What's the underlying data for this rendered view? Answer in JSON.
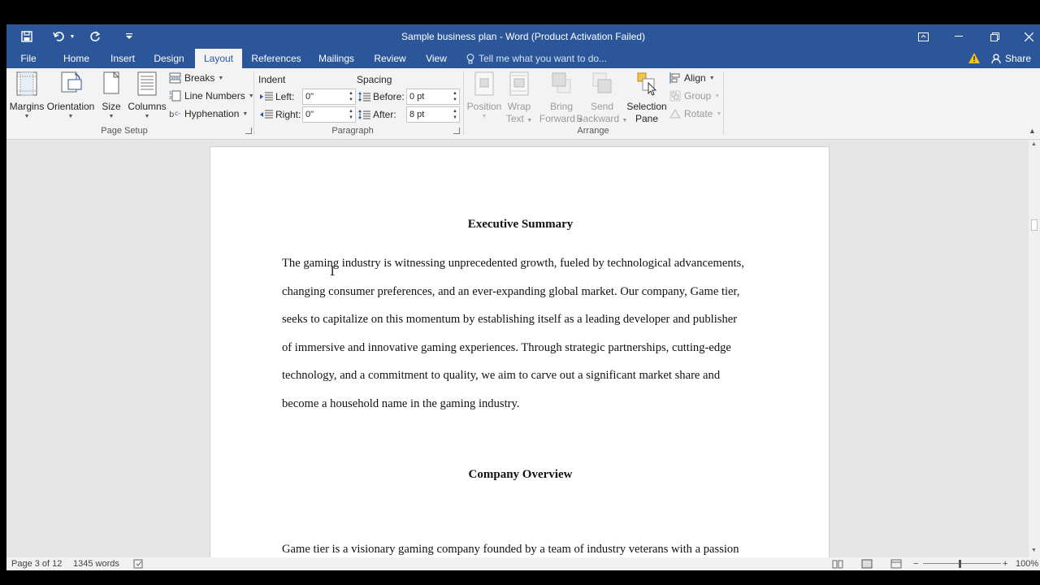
{
  "window": {
    "title": "Sample business plan - Word (Product Activation Failed)"
  },
  "quick_access": {
    "save_icon": "save-icon",
    "undo_icon": "undo-icon",
    "redo_icon": "redo-icon",
    "customize_icon": "customize-qat-icon"
  },
  "tabs": [
    {
      "label": "File"
    },
    {
      "label": "Home"
    },
    {
      "label": "Insert"
    },
    {
      "label": "Design"
    },
    {
      "label": "Layout",
      "active": true
    },
    {
      "label": "References"
    },
    {
      "label": "Mailings"
    },
    {
      "label": "Review"
    },
    {
      "label": "View"
    }
  ],
  "tell_me": "Tell me what you want to do...",
  "share_label": "Share",
  "ribbon": {
    "page_setup": {
      "group_label": "Page Setup",
      "margins": "Margins",
      "orientation": "Orientation",
      "size": "Size",
      "columns": "Columns",
      "breaks": "Breaks",
      "line_numbers": "Line Numbers",
      "hyphenation": "Hyphenation"
    },
    "paragraph": {
      "group_label": "Paragraph",
      "indent_label": "Indent",
      "spacing_label": "Spacing",
      "left_label": "Left:",
      "left_value": "0\"",
      "right_label": "Right:",
      "right_value": "0\"",
      "before_label": "Before:",
      "before_value": "0 pt",
      "after_label": "After:",
      "after_value": "8 pt"
    },
    "arrange": {
      "group_label": "Arrange",
      "position": "Position",
      "wrap_1": "Wrap",
      "wrap_2": "Text",
      "bring_1": "Bring",
      "bring_2": "Forward",
      "send_1": "Send",
      "send_2": "Backward",
      "selection_1": "Selection",
      "selection_2": "Pane",
      "align": "Align",
      "group": "Group",
      "rotate": "Rotate"
    }
  },
  "document": {
    "heading1": "Executive Summary",
    "para1_lines": [
      "The gaming industry is witnessing unprecedented growth, fueled by technological advancements,",
      "changing consumer preferences, and an ever-expanding global market. Our company, Game tier,",
      "seeks to capitalize on this momentum by establishing itself as a leading developer and publisher",
      "of immersive and innovative gaming experiences. Through strategic partnerships, cutting-edge",
      "technology, and a commitment to quality, we aim to carve out a significant market share and",
      "become a household name in the gaming industry."
    ],
    "heading2": "Company Overview",
    "para2_lines": [
      "Game tier is a visionary gaming company founded by a team of industry veterans with a passion"
    ]
  },
  "status": {
    "page": "Page 3 of 12",
    "words": "1345 words",
    "zoom": "100%"
  }
}
